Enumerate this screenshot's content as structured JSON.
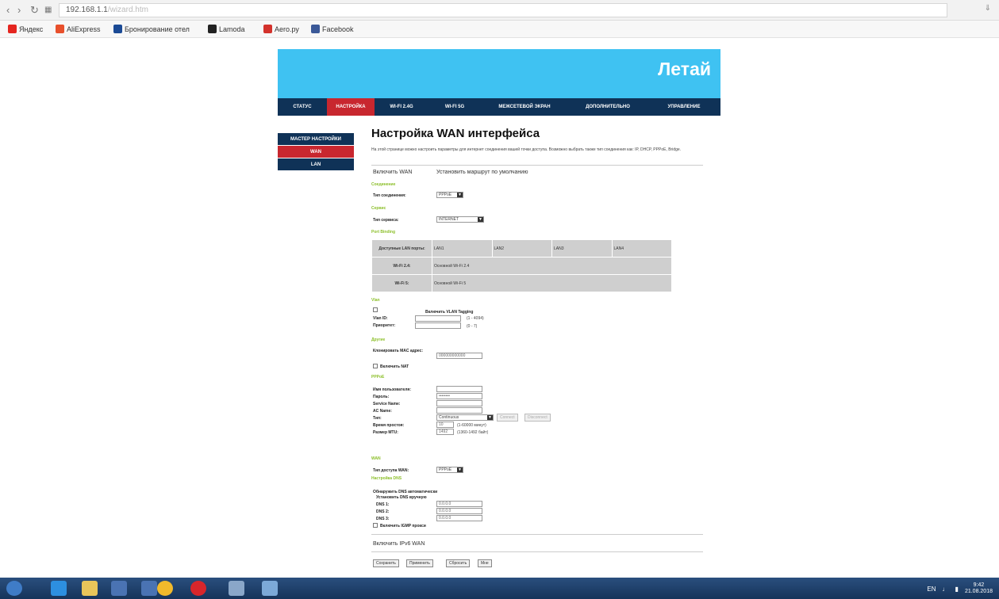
{
  "browser": {
    "url": "192.168.1.1",
    "url_faint": "/wizard.htm",
    "bookmarks": [
      "Яндекс",
      "AliExpress",
      "Бронирование отел",
      "Lamoda",
      "Aero.ру",
      "Facebook"
    ]
  },
  "router": {
    "brand": "Летай",
    "tabs": [
      "СТАТУС",
      "НАСТРОЙКА",
      "WI-FI 2.4G",
      "WI-FI 5G",
      "МЕЖСЕТЕВОЙ ЭКРАН",
      "ДОПОЛНИТЕЛЬНО",
      "УПРАВЛЕНИЕ"
    ],
    "active_tab": "НАСТРОЙКА",
    "side_menu": {
      "head": "МАСТЕР НАСТРОЙКИ",
      "wan": "WAN",
      "lan": "LAN"
    }
  },
  "page": {
    "title": "Настройка WAN интерфейса",
    "intro": "На этой странице можно настроить параметры для интернет соединения вашей точки доступа. Возможно выбрать также тип соединения как: IP, DHCP, PPPoE, Bridge.",
    "enable_wan": "Включить WAN",
    "set_default_route": "Установить маршрут по умолчанию",
    "sections": {
      "connection": "Соединение",
      "service": "Сервис",
      "port_binding": "Port Binding",
      "vlan": "Vlan",
      "ip": "Другие",
      "pppoe": "PPPoE",
      "wan": "WAN",
      "dns": "Настройка DNS"
    },
    "connection_type_label": "Тип соединения:",
    "connection_type_value": "PPPoE",
    "service_type_label": "Тип сервиса:",
    "service_type_value": "INTERNET",
    "port_binding": {
      "header": "Доступные LAN порты:",
      "lan": [
        "LAN1",
        "LAN2",
        "LAN3",
        "LAN4"
      ],
      "wifi24_label": "Wi-Fi 2.4:",
      "wifi24_value": "Основной Wi-Fi 2.4",
      "wifi5_label": "Wi-Fi 5:",
      "wifi5_value": "Основной Wi-Fi 5"
    },
    "vlan": {
      "enable_label": "Включить VLAN Tagging",
      "vlan_id_label": "Vlan ID:",
      "vlan_id_range": "(1 - 4094)",
      "priority_label": "Приоритет:",
      "priority_range": "(0 - 7)"
    },
    "mac_clone_label": "Клонировать MAC адрес:",
    "mac_clone_value": "000000000000",
    "enable_nat": "Включить NAT",
    "pppoe": {
      "username_label": "Имя пользователя:",
      "password_label": "Пароль:",
      "password_value": "••••••••",
      "service_name_label": "Service Name:",
      "ac_name_label": "AC Name:",
      "type_label": "Тип:",
      "type_value": "Continuous",
      "connect_btn": "Connect",
      "disconnect_btn": "Disconnect",
      "idle_label": "Время простоя:",
      "idle_value": "10",
      "idle_hint": "(1-60000 минут)",
      "mtu_label": "Размер MTU:",
      "mtu_value": "1492",
      "mtu_hint": "(1360-1492 байт)"
    },
    "wan_access_label": "Тип доступа WAN:",
    "wan_access_value": "PPPoE",
    "dns": {
      "auto": "Обнаружить DNS автоматически",
      "manual": "Установить DNS вручную",
      "dns1_label": "DNS 1:",
      "dns2_label": "DNS 2:",
      "dns3_label": "DNS 3:",
      "dns_value": "0.0.0.0",
      "igmp": "Включить IGMP прокси"
    },
    "enable_ipv6": "Включить IPv6 WAN",
    "buttons": [
      "Сохранить",
      "Применить",
      "Сбросить",
      "Мне"
    ]
  },
  "taskbar": {
    "tray_lang": "EN",
    "time": "9:42",
    "date": "21.08.2018"
  },
  "colors": {
    "banner": "#3fc2f2",
    "nav": "#0f3257",
    "active": "#c8272f",
    "section": "#8cbf2a"
  }
}
